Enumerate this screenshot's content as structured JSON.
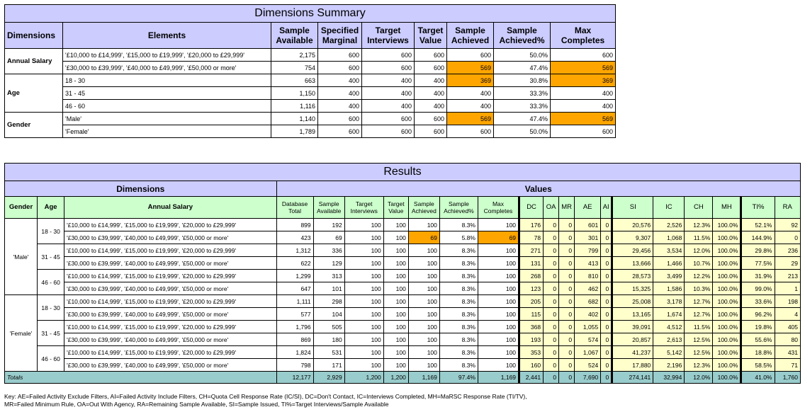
{
  "summary": {
    "title": "Dimensions Summary",
    "headers": [
      "Dimensions",
      "Elements",
      "Sample Available",
      "Specified Marginal",
      "Target Interviews",
      "Target Value",
      "Sample Achieved",
      "Sample Achieved%",
      "Max Completes"
    ],
    "groups": [
      {
        "name": "Annual Salary",
        "rows": [
          {
            "element": "'£10,000 to £14,999', '£15,000 to £19,999', '£20,000 to £29,999'",
            "values": [
              "2,175",
              "600",
              "600",
              "600",
              "600",
              "50.0%",
              "600"
            ],
            "highlight": false
          },
          {
            "element": "'£30,000 to £39,999', '£40,000 to £49,999', '£50,000 or more'",
            "values": [
              "754",
              "600",
              "600",
              "600",
              "569",
              "47.4%",
              "569"
            ],
            "highlight": true
          }
        ]
      },
      {
        "name": "Age",
        "rows": [
          {
            "element": "18 - 30",
            "values": [
              "663",
              "400",
              "400",
              "400",
              "369",
              "30.8%",
              "369"
            ],
            "highlight": true
          },
          {
            "element": "31 - 45",
            "values": [
              "1,150",
              "400",
              "400",
              "400",
              "400",
              "33.3%",
              "400"
            ],
            "highlight": false
          },
          {
            "element": "46 - 60",
            "values": [
              "1,116",
              "400",
              "400",
              "400",
              "400",
              "33.3%",
              "400"
            ],
            "highlight": false
          }
        ]
      },
      {
        "name": "Gender",
        "rows": [
          {
            "element": "'Male'",
            "values": [
              "1,140",
              "600",
              "600",
              "600",
              "569",
              "47.4%",
              "569"
            ],
            "highlight": true
          },
          {
            "element": "'Female'",
            "values": [
              "1,789",
              "600",
              "600",
              "600",
              "600",
              "50.0%",
              "600"
            ],
            "highlight": false
          }
        ]
      }
    ]
  },
  "results": {
    "title": "Results",
    "group_headers": {
      "dimensions": "Dimensions",
      "values": "Values"
    },
    "dim_headers": [
      "Gender",
      "Age",
      "Annual Salary"
    ],
    "value_headers": [
      "Database Total",
      "Sample Available",
      "Target Interviews",
      "Target Value",
      "Sample Achieved",
      "Sample Achieved%",
      "Max Completes"
    ],
    "metric_headers": [
      "DC",
      "OA",
      "MR",
      "AE",
      "AI",
      "SI",
      "IC",
      "CH",
      "MH",
      "TI%",
      "RA"
    ],
    "salary_labels": [
      "'£10,000 to £14,999', '£15,000 to £19,999', '£20,000 to £29,999'",
      "'£30,000 to £39,999', '£40,000 to £49,999', '£50,000 or more'"
    ],
    "genders": [
      {
        "name": "'Male'",
        "ages": [
          {
            "age": "18 - 30",
            "rows": [
              {
                "v": [
                  "899",
                  "192",
                  "100",
                  "100",
                  "100",
                  "8.3%",
                  "100"
                ],
                "m": [
                  "176",
                  "0",
                  "0",
                  "601",
                  "0",
                  "20,576",
                  "2,526",
                  "12.3%",
                  "100.0%",
                  "52.1%",
                  "92"
                ],
                "hl": false
              },
              {
                "v": [
                  "423",
                  "69",
                  "100",
                  "100",
                  "69",
                  "5.8%",
                  "69"
                ],
                "m": [
                  "78",
                  "0",
                  "0",
                  "301",
                  "0",
                  "9,307",
                  "1,068",
                  "11.5%",
                  "100.0%",
                  "144.9%",
                  "0"
                ],
                "hl": true
              }
            ]
          },
          {
            "age": "31 - 45",
            "rows": [
              {
                "v": [
                  "1,312",
                  "336",
                  "100",
                  "100",
                  "100",
                  "8.3%",
                  "100"
                ],
                "m": [
                  "271",
                  "0",
                  "0",
                  "799",
                  "0",
                  "29,456",
                  "3,534",
                  "12.0%",
                  "100.0%",
                  "29.8%",
                  "236"
                ],
                "hl": false
              },
              {
                "v": [
                  "622",
                  "129",
                  "100",
                  "100",
                  "100",
                  "8.3%",
                  "100"
                ],
                "m": [
                  "131",
                  "0",
                  "0",
                  "413",
                  "0",
                  "13,666",
                  "1,466",
                  "10.7%",
                  "100.0%",
                  "77.5%",
                  "29"
                ],
                "hl": false
              }
            ]
          },
          {
            "age": "46 - 60",
            "rows": [
              {
                "v": [
                  "1,299",
                  "313",
                  "100",
                  "100",
                  "100",
                  "8.3%",
                  "100"
                ],
                "m": [
                  "268",
                  "0",
                  "0",
                  "810",
                  "0",
                  "28,573",
                  "3,499",
                  "12.2%",
                  "100.0%",
                  "31.9%",
                  "213"
                ],
                "hl": false
              },
              {
                "v": [
                  "647",
                  "101",
                  "100",
                  "100",
                  "100",
                  "8.3%",
                  "100"
                ],
                "m": [
                  "123",
                  "0",
                  "0",
                  "462",
                  "0",
                  "15,325",
                  "1,586",
                  "10.3%",
                  "100.0%",
                  "99.0%",
                  "1"
                ],
                "hl": false
              }
            ]
          }
        ]
      },
      {
        "name": "'Female'",
        "ages": [
          {
            "age": "18 - 30",
            "rows": [
              {
                "v": [
                  "1,111",
                  "298",
                  "100",
                  "100",
                  "100",
                  "8.3%",
                  "100"
                ],
                "m": [
                  "205",
                  "0",
                  "0",
                  "682",
                  "0",
                  "25,008",
                  "3,178",
                  "12.7%",
                  "100.0%",
                  "33.6%",
                  "198"
                ],
                "hl": false
              },
              {
                "v": [
                  "577",
                  "104",
                  "100",
                  "100",
                  "100",
                  "8.3%",
                  "100"
                ],
                "m": [
                  "115",
                  "0",
                  "0",
                  "402",
                  "0",
                  "13,165",
                  "1,674",
                  "12.7%",
                  "100.0%",
                  "96.2%",
                  "4"
                ],
                "hl": false
              }
            ]
          },
          {
            "age": "31 - 45",
            "rows": [
              {
                "v": [
                  "1,796",
                  "505",
                  "100",
                  "100",
                  "100",
                  "8.3%",
                  "100"
                ],
                "m": [
                  "368",
                  "0",
                  "0",
                  "1,055",
                  "0",
                  "39,091",
                  "4,512",
                  "11.5%",
                  "100.0%",
                  "19.8%",
                  "405"
                ],
                "hl": false
              },
              {
                "v": [
                  "869",
                  "180",
                  "100",
                  "100",
                  "100",
                  "8.3%",
                  "100"
                ],
                "m": [
                  "193",
                  "0",
                  "0",
                  "574",
                  "0",
                  "20,857",
                  "2,613",
                  "12.5%",
                  "100.0%",
                  "55.6%",
                  "80"
                ],
                "hl": false
              }
            ]
          },
          {
            "age": "46 - 60",
            "rows": [
              {
                "v": [
                  "1,824",
                  "531",
                  "100",
                  "100",
                  "100",
                  "8.3%",
                  "100"
                ],
                "m": [
                  "353",
                  "0",
                  "0",
                  "1,067",
                  "0",
                  "41,237",
                  "5,142",
                  "12.5%",
                  "100.0%",
                  "18.8%",
                  "431"
                ],
                "hl": false
              },
              {
                "v": [
                  "798",
                  "171",
                  "100",
                  "100",
                  "100",
                  "8.3%",
                  "100"
                ],
                "m": [
                  "160",
                  "0",
                  "0",
                  "524",
                  "0",
                  "17,880",
                  "2,196",
                  "12.3%",
                  "100.0%",
                  "58.5%",
                  "71"
                ],
                "hl": false
              }
            ]
          }
        ]
      }
    ],
    "totals": {
      "label": "Totals",
      "v": [
        "12,177",
        "2,929",
        "1,200",
        "1,200",
        "1,169",
        "97.4%",
        "1,169"
      ],
      "m": [
        "2,441",
        "0",
        "0",
        "7,690",
        "0",
        "274,141",
        "32,994",
        "12.0%",
        "100.0%",
        "41.0%",
        "1,760"
      ]
    }
  },
  "key_text": [
    "Key: AE=Failed Activity Exclude Filters, AI=Failed Activity Include Filters, CH=Quota Cell Response Rate (IC/SI), DC=Don't Contact, IC=Interviews Completed, MH=MaRSC Response Rate (TI/TV),",
    "MR=Failed Minimum Rule, OA=Out With Agency, RA=Remaining Sample Available, SI=Sample Issued, TI%=Target Interviews/Sample Available"
  ],
  "colors": {
    "header": "#ccccff",
    "subheader": "#ccffcc",
    "metrics": "#ffffcc",
    "highlight": "#ffa500",
    "totals": "#99cccc"
  }
}
